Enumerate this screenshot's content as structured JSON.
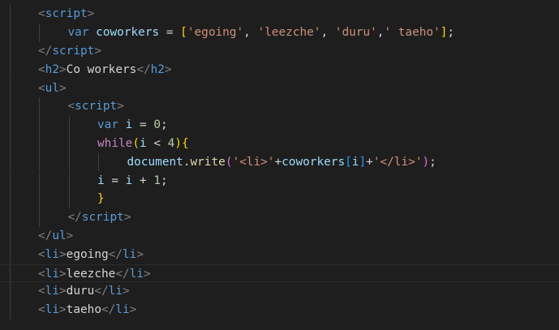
{
  "editor": {
    "language": "html",
    "current_line_index": 14,
    "lines": [
      {
        "indent": 1,
        "guides": [
          1
        ],
        "tokens": [
          {
            "c": "t-tag",
            "t": "<"
          },
          {
            "c": "t-name",
            "t": "script"
          },
          {
            "c": "t-tag",
            "t": ">"
          }
        ]
      },
      {
        "indent": 2,
        "guides": [
          1,
          2
        ],
        "tokens": [
          {
            "c": "t-kw",
            "t": "var"
          },
          {
            "c": "t-op",
            "t": " "
          },
          {
            "c": "t-var",
            "t": "coworkers"
          },
          {
            "c": "t-op",
            "t": " = "
          },
          {
            "c": "t-br1",
            "t": "["
          },
          {
            "c": "t-str",
            "t": "'egoing'"
          },
          {
            "c": "t-op",
            "t": ", "
          },
          {
            "c": "t-str",
            "t": "'leezche'"
          },
          {
            "c": "t-op",
            "t": ", "
          },
          {
            "c": "t-str",
            "t": "'duru'"
          },
          {
            "c": "t-op",
            "t": ","
          },
          {
            "c": "t-str",
            "t": "' taeho'"
          },
          {
            "c": "t-br1",
            "t": "]"
          },
          {
            "c": "t-op",
            "t": ";"
          }
        ]
      },
      {
        "indent": 1,
        "guides": [
          1
        ],
        "tokens": [
          {
            "c": "t-tag",
            "t": "</"
          },
          {
            "c": "t-name",
            "t": "script"
          },
          {
            "c": "t-tag",
            "t": ">"
          }
        ]
      },
      {
        "indent": 1,
        "guides": [
          1
        ],
        "tokens": [
          {
            "c": "t-tag",
            "t": "<"
          },
          {
            "c": "t-name",
            "t": "h2"
          },
          {
            "c": "t-tag",
            "t": ">"
          },
          {
            "c": "t-text",
            "t": "Co workers"
          },
          {
            "c": "t-tag",
            "t": "</"
          },
          {
            "c": "t-name",
            "t": "h2"
          },
          {
            "c": "t-tag",
            "t": ">"
          }
        ]
      },
      {
        "indent": 1,
        "guides": [
          1
        ],
        "tokens": [
          {
            "c": "t-tag",
            "t": "<"
          },
          {
            "c": "t-name",
            "t": "ul"
          },
          {
            "c": "t-tag",
            "t": ">"
          }
        ]
      },
      {
        "indent": 2,
        "guides": [
          1,
          2
        ],
        "tokens": [
          {
            "c": "t-tag",
            "t": "<"
          },
          {
            "c": "t-name",
            "t": "script"
          },
          {
            "c": "t-tag",
            "t": ">"
          }
        ]
      },
      {
        "indent": 3,
        "guides": [
          1,
          2,
          3
        ],
        "tokens": [
          {
            "c": "t-kw",
            "t": "var"
          },
          {
            "c": "t-op",
            "t": " "
          },
          {
            "c": "t-var",
            "t": "i"
          },
          {
            "c": "t-op",
            "t": " = "
          },
          {
            "c": "t-num",
            "t": "0"
          },
          {
            "c": "t-op",
            "t": ";"
          }
        ]
      },
      {
        "indent": 3,
        "guides": [
          1,
          2,
          3
        ],
        "tokens": [
          {
            "c": "t-ctrl",
            "t": "while"
          },
          {
            "c": "t-br1",
            "t": "("
          },
          {
            "c": "t-var",
            "t": "i"
          },
          {
            "c": "t-op",
            "t": " < "
          },
          {
            "c": "t-num",
            "t": "4"
          },
          {
            "c": "t-br1",
            "t": ")"
          },
          {
            "c": "t-br1",
            "t": "{"
          }
        ]
      },
      {
        "indent": 4,
        "guides": [
          1,
          2,
          3,
          4
        ],
        "tokens": [
          {
            "c": "t-var",
            "t": "document"
          },
          {
            "c": "t-op",
            "t": "."
          },
          {
            "c": "t-fn",
            "t": "write"
          },
          {
            "c": "t-br2",
            "t": "("
          },
          {
            "c": "t-str",
            "t": "'<li>'"
          },
          {
            "c": "t-op",
            "t": "+"
          },
          {
            "c": "t-var",
            "t": "coworkers"
          },
          {
            "c": "t-br3",
            "t": "["
          },
          {
            "c": "t-var",
            "t": "i"
          },
          {
            "c": "t-br3",
            "t": "]"
          },
          {
            "c": "t-op",
            "t": "+"
          },
          {
            "c": "t-str",
            "t": "'</li>'"
          },
          {
            "c": "t-br2",
            "t": ")"
          },
          {
            "c": "t-op",
            "t": ";"
          }
        ]
      },
      {
        "indent": 3,
        "guides": [
          1,
          2,
          3
        ],
        "tokens": [
          {
            "c": "t-var",
            "t": "i"
          },
          {
            "c": "t-op",
            "t": " = "
          },
          {
            "c": "t-var",
            "t": "i"
          },
          {
            "c": "t-op",
            "t": " + "
          },
          {
            "c": "t-num",
            "t": "1"
          },
          {
            "c": "t-op",
            "t": ";"
          }
        ]
      },
      {
        "indent": 3,
        "guides": [
          1,
          2,
          3
        ],
        "tokens": [
          {
            "c": "t-br1",
            "t": "}"
          }
        ]
      },
      {
        "indent": 2,
        "guides": [
          1,
          2
        ],
        "tokens": [
          {
            "c": "t-tag",
            "t": "</"
          },
          {
            "c": "t-name",
            "t": "script"
          },
          {
            "c": "t-tag",
            "t": ">"
          }
        ]
      },
      {
        "indent": 1,
        "guides": [
          1
        ],
        "tokens": [
          {
            "c": "t-tag",
            "t": "</"
          },
          {
            "c": "t-name",
            "t": "ul"
          },
          {
            "c": "t-tag",
            "t": ">"
          }
        ]
      },
      {
        "indent": 1,
        "guides": [
          1
        ],
        "tokens": [
          {
            "c": "t-tag",
            "t": "<"
          },
          {
            "c": "t-name",
            "t": "li"
          },
          {
            "c": "t-tag",
            "t": ">"
          },
          {
            "c": "t-text",
            "t": "egoing"
          },
          {
            "c": "t-tag",
            "t": "</"
          },
          {
            "c": "t-name",
            "t": "li"
          },
          {
            "c": "t-tag",
            "t": ">"
          }
        ]
      },
      {
        "indent": 1,
        "guides": [
          1
        ],
        "tokens": [
          {
            "c": "t-tag",
            "t": "<"
          },
          {
            "c": "t-name",
            "t": "li"
          },
          {
            "c": "t-tag",
            "t": ">"
          },
          {
            "c": "t-text",
            "t": "leezche"
          },
          {
            "c": "t-tag",
            "t": "</"
          },
          {
            "c": "t-name",
            "t": "li"
          },
          {
            "c": "t-tag",
            "t": ">"
          }
        ]
      },
      {
        "indent": 1,
        "guides": [
          1
        ],
        "tokens": [
          {
            "c": "t-tag",
            "t": "<"
          },
          {
            "c": "t-name",
            "t": "li"
          },
          {
            "c": "t-tag",
            "t": ">"
          },
          {
            "c": "t-text",
            "t": "duru"
          },
          {
            "c": "t-tag",
            "t": "</"
          },
          {
            "c": "t-name",
            "t": "li"
          },
          {
            "c": "t-tag",
            "t": ">"
          }
        ]
      },
      {
        "indent": 1,
        "guides": [
          1
        ],
        "tokens": [
          {
            "c": "t-tag",
            "t": "<"
          },
          {
            "c": "t-name",
            "t": "li"
          },
          {
            "c": "t-tag",
            "t": ">"
          },
          {
            "c": "t-text",
            "t": "taeho"
          },
          {
            "c": "t-tag",
            "t": "</"
          },
          {
            "c": "t-name",
            "t": "li"
          },
          {
            "c": "t-tag",
            "t": ">"
          }
        ]
      }
    ]
  },
  "colors": {
    "background": "#1e1e1e",
    "tag_bracket": "#808080",
    "tag_name": "#569cd6",
    "keyword": "#569cd6",
    "control": "#c586c0",
    "variable": "#9cdcfe",
    "string": "#ce9178",
    "number": "#b5cea8",
    "function": "#dcdcaa",
    "text": "#d4d4d4"
  }
}
